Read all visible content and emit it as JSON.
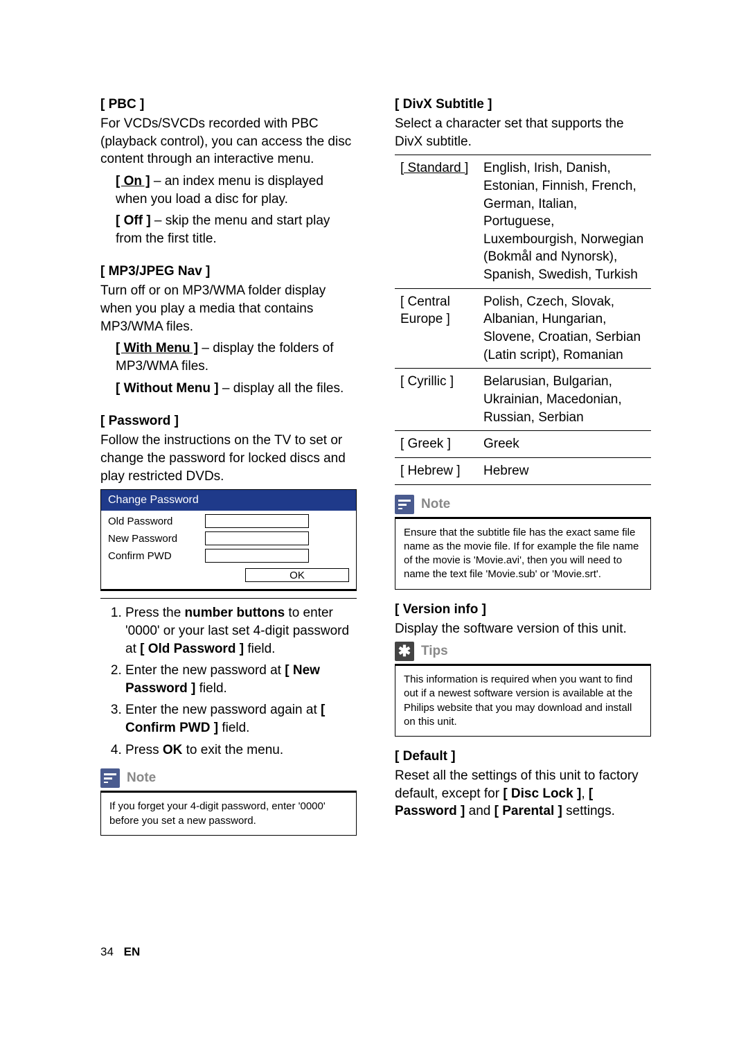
{
  "left": {
    "pbc": {
      "title": "[ PBC ]",
      "desc": "For VCDs/SVCDs recorded with PBC (playback control), you can access the disc content through an interactive menu.",
      "on": {
        "label": "[ On ]",
        "text": " – an index menu is displayed when you load a disc for play."
      },
      "off": {
        "label": "[ Off ]",
        "text": " – skip the menu and start play from the ﬁrst title."
      }
    },
    "mp3": {
      "title": "[ MP3/JPEG Nav ]",
      "desc": "Turn off or on MP3/WMA folder display when you play a media that contains MP3/WMA ﬁles.",
      "with": {
        "label": "[ With Menu ]",
        "text": " – display the folders of MP3/WMA ﬁles."
      },
      "without": {
        "label": "[ Without Menu ]",
        "text": " – display all the ﬁles."
      }
    },
    "password": {
      "title": "[ Password ]",
      "desc": "Follow the instructions on the TV to set or change the password for locked discs and play restricted DVDs.",
      "box": {
        "header": "Change Password",
        "old": "Old Password",
        "new": "New Password",
        "confirm": "Confirm PWD",
        "ok": "OK"
      },
      "steps": {
        "s1a": "Press the ",
        "s1b": "number buttons",
        "s1c": " to enter '0000' or your last set 4-digit password at ",
        "s1d": "[ Old Password ]",
        "s1e": " ﬁeld.",
        "s2a": "Enter the new password at ",
        "s2b": "[ New Password ]",
        "s2c": " ﬁeld.",
        "s3a": "Enter the new password again at ",
        "s3b": "[ Conﬁrm PWD ]",
        "s3c": " ﬁeld.",
        "s4a": "Press ",
        "s4b": "OK",
        "s4c": " to exit the menu."
      },
      "note": {
        "title": "Note",
        "body": "If you forget your 4-digit password, enter '0000' before you set a new password."
      }
    }
  },
  "right": {
    "divx": {
      "title": "[ DivX Subtitle ]",
      "desc": "Select a character set that supports the DivX subtitle.",
      "rows": [
        {
          "key": "[ Standard ]",
          "underline": true,
          "val": "English, Irish, Danish, Estonian, Finnish, French, German, Italian, Portuguese, Luxembourgish, Norwegian (Bokmål and Nynorsk), Spanish, Swedish, Turkish"
        },
        {
          "key": "[ Central Europe ]",
          "underline": false,
          "val": "Polish, Czech, Slovak, Albanian, Hungarian, Slovene, Croatian, Serbian (Latin script), Romanian"
        },
        {
          "key": "[ Cyrillic ]",
          "underline": false,
          "val": "Belarusian, Bulgarian, Ukrainian, Macedonian, Russian, Serbian"
        },
        {
          "key": "[ Greek ]",
          "underline": false,
          "val": "Greek"
        },
        {
          "key": "[ Hebrew ]",
          "underline": false,
          "val": "Hebrew"
        }
      ],
      "note": {
        "title": "Note",
        "body": "Ensure that the subtitle ﬁle has the exact same ﬁle name as the movie ﬁle. If for example the ﬁle name of the movie is 'Movie.avi', then you will need to name the text ﬁle 'Movie.sub' or 'Movie.srt'."
      }
    },
    "version": {
      "title": "[ Version info ]",
      "desc": "Display the software version of this unit.",
      "tips": {
        "title": "Tips",
        "body": "This information is required when you want to ﬁnd out if a newest software version is available at the Philips website that you may download and install on this unit."
      }
    },
    "default": {
      "title": "[ Default ]",
      "a": "Reset all the settings of this unit to factory default, except for ",
      "b": "[ Disc Lock ]",
      "c": ", ",
      "d": "[ Password ]",
      "e": " and ",
      "f": "[ Parental ]",
      "g": " settings."
    }
  },
  "footer": {
    "page": "34",
    "lang": "EN"
  }
}
